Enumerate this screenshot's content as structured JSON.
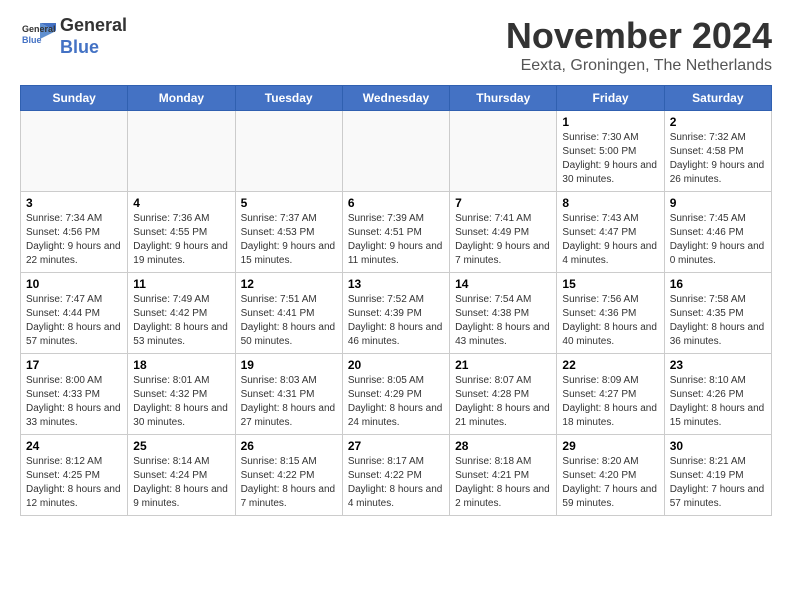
{
  "header": {
    "logo_line1": "General",
    "logo_line2": "Blue",
    "month_title": "November 2024",
    "subtitle": "Eexta, Groningen, The Netherlands"
  },
  "days_of_week": [
    "Sunday",
    "Monday",
    "Tuesday",
    "Wednesday",
    "Thursday",
    "Friday",
    "Saturday"
  ],
  "weeks": [
    [
      {
        "day": "",
        "info": "",
        "empty": true
      },
      {
        "day": "",
        "info": "",
        "empty": true
      },
      {
        "day": "",
        "info": "",
        "empty": true
      },
      {
        "day": "",
        "info": "",
        "empty": true
      },
      {
        "day": "",
        "info": "",
        "empty": true
      },
      {
        "day": "1",
        "info": "Sunrise: 7:30 AM\nSunset: 5:00 PM\nDaylight: 9 hours and 30 minutes.",
        "empty": false
      },
      {
        "day": "2",
        "info": "Sunrise: 7:32 AM\nSunset: 4:58 PM\nDaylight: 9 hours and 26 minutes.",
        "empty": false
      }
    ],
    [
      {
        "day": "3",
        "info": "Sunrise: 7:34 AM\nSunset: 4:56 PM\nDaylight: 9 hours and 22 minutes.",
        "empty": false
      },
      {
        "day": "4",
        "info": "Sunrise: 7:36 AM\nSunset: 4:55 PM\nDaylight: 9 hours and 19 minutes.",
        "empty": false
      },
      {
        "day": "5",
        "info": "Sunrise: 7:37 AM\nSunset: 4:53 PM\nDaylight: 9 hours and 15 minutes.",
        "empty": false
      },
      {
        "day": "6",
        "info": "Sunrise: 7:39 AM\nSunset: 4:51 PM\nDaylight: 9 hours and 11 minutes.",
        "empty": false
      },
      {
        "day": "7",
        "info": "Sunrise: 7:41 AM\nSunset: 4:49 PM\nDaylight: 9 hours and 7 minutes.",
        "empty": false
      },
      {
        "day": "8",
        "info": "Sunrise: 7:43 AM\nSunset: 4:47 PM\nDaylight: 9 hours and 4 minutes.",
        "empty": false
      },
      {
        "day": "9",
        "info": "Sunrise: 7:45 AM\nSunset: 4:46 PM\nDaylight: 9 hours and 0 minutes.",
        "empty": false
      }
    ],
    [
      {
        "day": "10",
        "info": "Sunrise: 7:47 AM\nSunset: 4:44 PM\nDaylight: 8 hours and 57 minutes.",
        "empty": false
      },
      {
        "day": "11",
        "info": "Sunrise: 7:49 AM\nSunset: 4:42 PM\nDaylight: 8 hours and 53 minutes.",
        "empty": false
      },
      {
        "day": "12",
        "info": "Sunrise: 7:51 AM\nSunset: 4:41 PM\nDaylight: 8 hours and 50 minutes.",
        "empty": false
      },
      {
        "day": "13",
        "info": "Sunrise: 7:52 AM\nSunset: 4:39 PM\nDaylight: 8 hours and 46 minutes.",
        "empty": false
      },
      {
        "day": "14",
        "info": "Sunrise: 7:54 AM\nSunset: 4:38 PM\nDaylight: 8 hours and 43 minutes.",
        "empty": false
      },
      {
        "day": "15",
        "info": "Sunrise: 7:56 AM\nSunset: 4:36 PM\nDaylight: 8 hours and 40 minutes.",
        "empty": false
      },
      {
        "day": "16",
        "info": "Sunrise: 7:58 AM\nSunset: 4:35 PM\nDaylight: 8 hours and 36 minutes.",
        "empty": false
      }
    ],
    [
      {
        "day": "17",
        "info": "Sunrise: 8:00 AM\nSunset: 4:33 PM\nDaylight: 8 hours and 33 minutes.",
        "empty": false
      },
      {
        "day": "18",
        "info": "Sunrise: 8:01 AM\nSunset: 4:32 PM\nDaylight: 8 hours and 30 minutes.",
        "empty": false
      },
      {
        "day": "19",
        "info": "Sunrise: 8:03 AM\nSunset: 4:31 PM\nDaylight: 8 hours and 27 minutes.",
        "empty": false
      },
      {
        "day": "20",
        "info": "Sunrise: 8:05 AM\nSunset: 4:29 PM\nDaylight: 8 hours and 24 minutes.",
        "empty": false
      },
      {
        "day": "21",
        "info": "Sunrise: 8:07 AM\nSunset: 4:28 PM\nDaylight: 8 hours and 21 minutes.",
        "empty": false
      },
      {
        "day": "22",
        "info": "Sunrise: 8:09 AM\nSunset: 4:27 PM\nDaylight: 8 hours and 18 minutes.",
        "empty": false
      },
      {
        "day": "23",
        "info": "Sunrise: 8:10 AM\nSunset: 4:26 PM\nDaylight: 8 hours and 15 minutes.",
        "empty": false
      }
    ],
    [
      {
        "day": "24",
        "info": "Sunrise: 8:12 AM\nSunset: 4:25 PM\nDaylight: 8 hours and 12 minutes.",
        "empty": false
      },
      {
        "day": "25",
        "info": "Sunrise: 8:14 AM\nSunset: 4:24 PM\nDaylight: 8 hours and 9 minutes.",
        "empty": false
      },
      {
        "day": "26",
        "info": "Sunrise: 8:15 AM\nSunset: 4:22 PM\nDaylight: 8 hours and 7 minutes.",
        "empty": false
      },
      {
        "day": "27",
        "info": "Sunrise: 8:17 AM\nSunset: 4:22 PM\nDaylight: 8 hours and 4 minutes.",
        "empty": false
      },
      {
        "day": "28",
        "info": "Sunrise: 8:18 AM\nSunset: 4:21 PM\nDaylight: 8 hours and 2 minutes.",
        "empty": false
      },
      {
        "day": "29",
        "info": "Sunrise: 8:20 AM\nSunset: 4:20 PM\nDaylight: 7 hours and 59 minutes.",
        "empty": false
      },
      {
        "day": "30",
        "info": "Sunrise: 8:21 AM\nSunset: 4:19 PM\nDaylight: 7 hours and 57 minutes.",
        "empty": false
      }
    ]
  ]
}
